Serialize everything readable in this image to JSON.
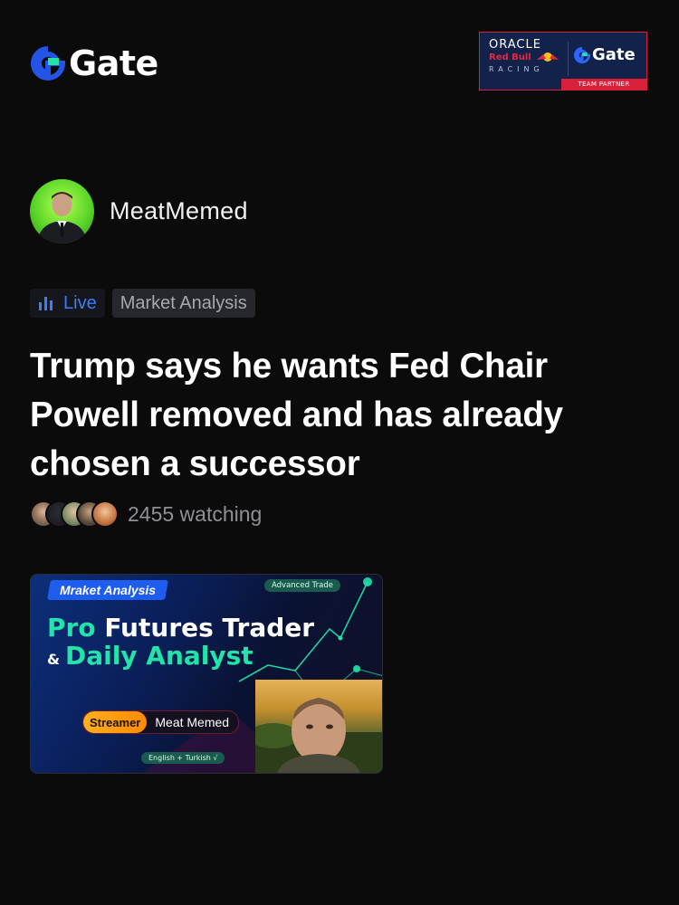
{
  "brand": {
    "logo_text": "Gate"
  },
  "partner": {
    "oracle": "ORACLE",
    "redbull": "Red Bull",
    "racing": "RACING",
    "gate": "Gate",
    "badge": "TEAM PARTNER"
  },
  "author": {
    "name": "MeatMemed"
  },
  "tags": {
    "live": "Live",
    "category": "Market Analysis"
  },
  "headline": "Trump says he wants Fed Chair Powell removed and has already chosen a successor",
  "watchers": {
    "text": "2455 watching"
  },
  "thumbnail": {
    "category": "Mraket Analysis",
    "advanced": "Advanced Trade",
    "line1_green": "Pro",
    "line1_white": "Futures Trader",
    "line2_amp": "&",
    "line2_green": "Daily Analyst",
    "streamer_label": "Streamer",
    "streamer_name": "Meat Memed",
    "languages": "English + Turkish √"
  },
  "colors": {
    "accent_blue": "#3d7df5",
    "brand_blue": "#2354e6",
    "accent_green": "#22e3a8",
    "background": "#0b0b0c"
  },
  "icons": {
    "logo": "gate-logo-icon",
    "live": "bar-chart-icon",
    "avatar": "user-avatar"
  }
}
